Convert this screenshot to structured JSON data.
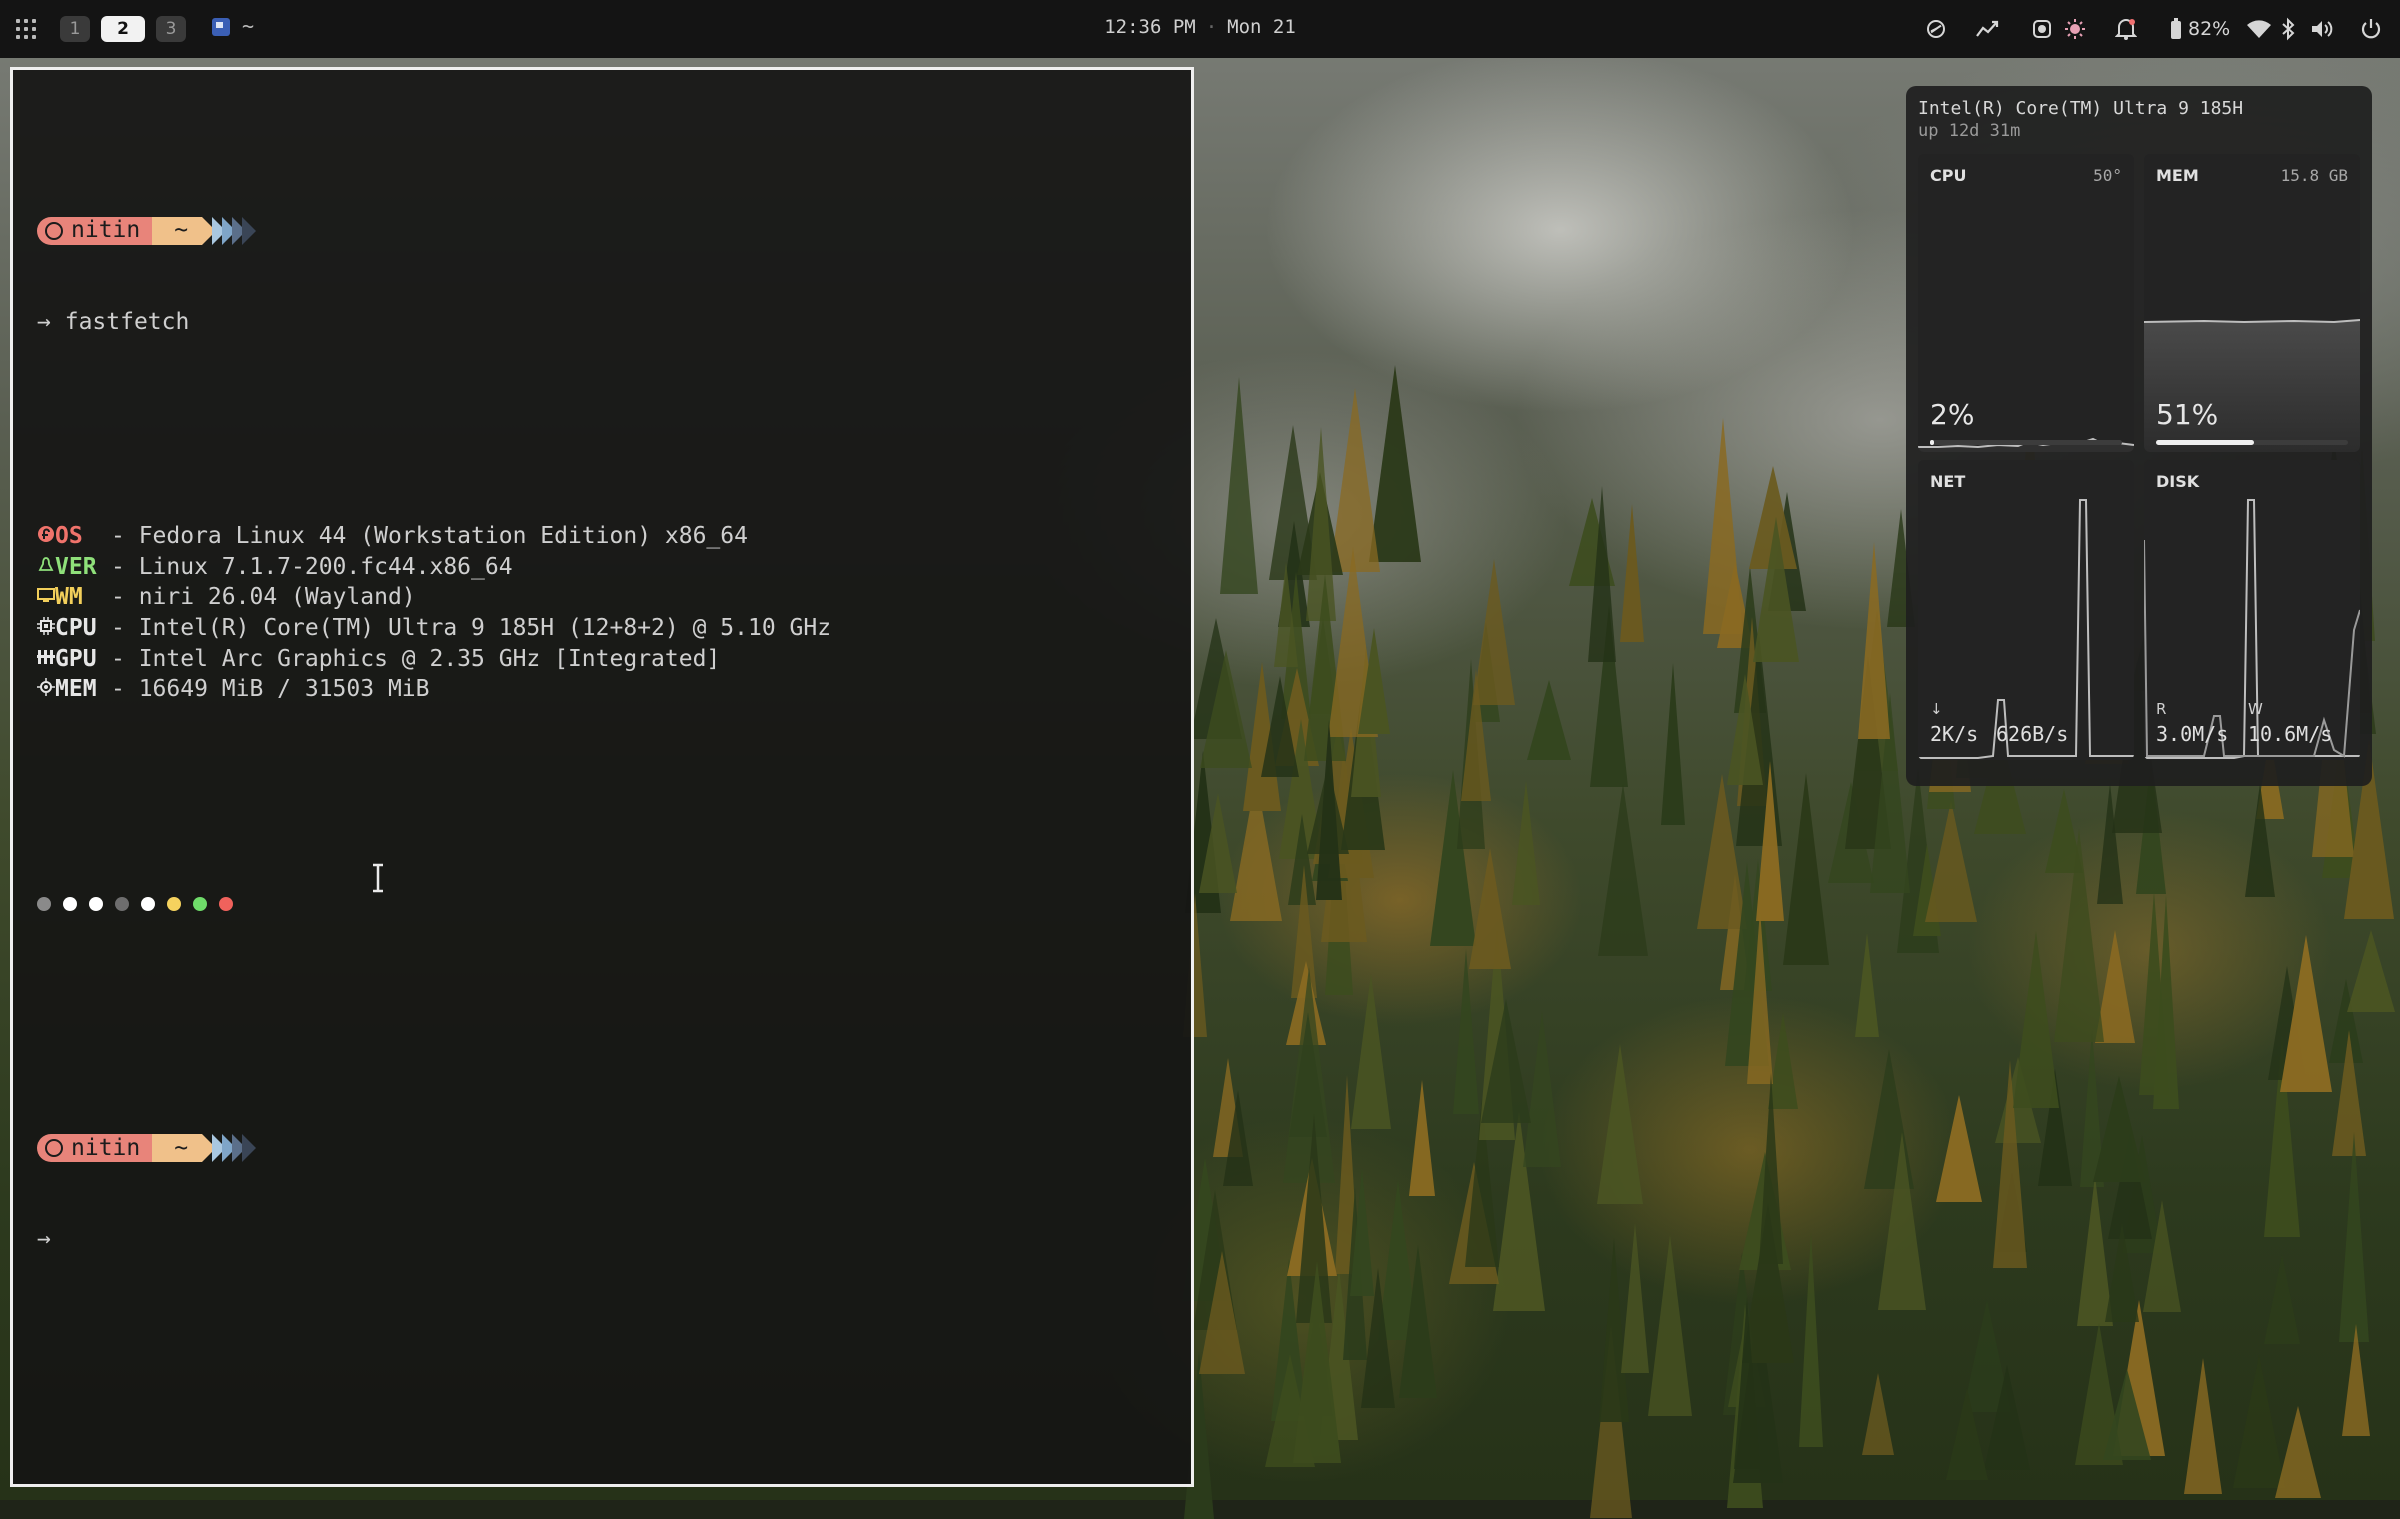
{
  "topbar": {
    "workspaces": [
      {
        "label": "1",
        "active": false
      },
      {
        "label": "2",
        "active": true
      },
      {
        "label": "3",
        "active": false
      }
    ],
    "window_title": "~",
    "clock": {
      "time": "12:36 PM",
      "separator": "·",
      "date": "Mon 21"
    },
    "battery": "82%",
    "tray_icons": [
      "no-disturb-icon",
      "activity-icon",
      "record-icon",
      "sun-icon",
      "bell-icon",
      "battery-icon",
      "wifi-icon",
      "bluetooth-icon",
      "volume-icon",
      "power-icon"
    ]
  },
  "terminal": {
    "prompt_user": "nitin",
    "prompt_dir": "~",
    "prompt_arrow": "→",
    "command": "fastfetch",
    "info": [
      {
        "label": "OS",
        "value": "- Fedora Linux 44 (Workstation Edition) x86_64",
        "color": "#f0736b",
        "icon": "fedora-icon"
      },
      {
        "label": "VER",
        "value": "- Linux 7.1.7-200.fc44.x86_64",
        "color": "#8fe07a",
        "icon": "tux-icon"
      },
      {
        "label": "WM",
        "value": "- niri 26.04 (Wayland)",
        "color": "#f2cf5b",
        "icon": "monitor-icon"
      },
      {
        "label": "CPU",
        "value": "- Intel(R) Core(TM) Ultra 9 185H (12+8+2) @ 5.10 GHz",
        "color": "#e6e6e6",
        "icon": "cpu-icon"
      },
      {
        "label": "GPU",
        "value": "- Intel Arc Graphics @ 2.35 GHz [Integrated]",
        "color": "#e6e6e6",
        "icon": "gpu-icon"
      },
      {
        "label": "MEM",
        "value": "- 16649 MiB / 31503 MiB",
        "color": "#e6e6e6",
        "icon": "memory-icon"
      }
    ],
    "palette": [
      "#8a8a8a",
      "#ffffff",
      "#ffffff",
      "#6e6e6e",
      "#ffffff",
      "#f5d25e",
      "#6fdc6a",
      "#f0625c"
    ],
    "colors": {
      "prompt_seg1": "#e8847a",
      "prompt_seg2": "#f0c18a",
      "chevrons": [
        "#e8a38a",
        "#a9c7e0",
        "#7fa5c8",
        "#5b6f8a",
        "#3a4556"
      ]
    }
  },
  "monitor": {
    "title": "Intel(R) Core(TM) Ultra 9 185H",
    "uptime": "up 12d 31m",
    "cpu": {
      "label": "CPU",
      "temp": "50°",
      "percent_text": "2%",
      "fraction": 0.02
    },
    "mem": {
      "label": "MEM",
      "total": "15.8 GB",
      "percent_text": "51%",
      "fraction": 0.51
    },
    "net": {
      "label": "NET",
      "down_icon": "↓",
      "down": "2K/s",
      "up": "626B/s"
    },
    "disk": {
      "label": "DISK",
      "read_label": "R",
      "write_label": "W",
      "read": "3.0M/s",
      "write": "10.6M/s"
    }
  }
}
